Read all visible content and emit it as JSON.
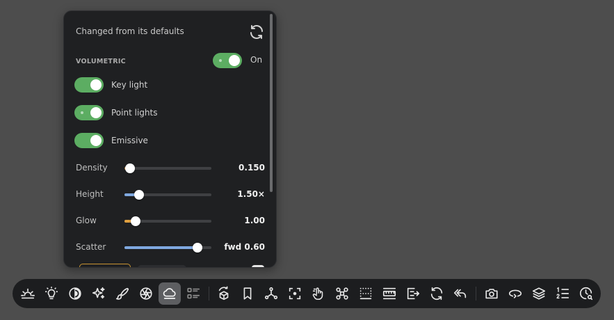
{
  "panel": {
    "header": "Changed from its defaults",
    "section": {
      "label": "VOLUMETRIC",
      "toggle_state": "On"
    },
    "toggles": [
      {
        "label": "Key light",
        "on": true
      },
      {
        "label": "Point lights",
        "on": true
      },
      {
        "label": "Emissive",
        "on": true
      }
    ],
    "sliders": [
      {
        "label": "Density",
        "value": "0.150",
        "fraction": 0.06,
        "fill_color": "#c98a3a"
      },
      {
        "label": "Height",
        "value": "1.50×",
        "fraction": 0.17,
        "fill_color": "#7fa8e0"
      },
      {
        "label": "Glow",
        "value": "1.00",
        "fraction": 0.13,
        "fill_color": "#e0a040"
      },
      {
        "label": "Scatter",
        "value": "fwd 0.60",
        "fraction": 0.84,
        "fill_color": "#7fa8e0"
      }
    ]
  },
  "toolbar": {
    "active": "fog-cloud-icon",
    "buttons": [
      "sunrise-icon",
      "lightbulb-icon",
      "contrast-icon",
      "sparkles-icon",
      "brush-icon",
      "aperture-icon",
      "fog-cloud-icon",
      "list-icon",
      "cube-rotate-icon",
      "bookmark-icon",
      "nodes-icon",
      "focus-icon",
      "hand-pointer-icon",
      "drone-icon",
      "grid-dots-icon",
      "ruler-icon",
      "export-icon",
      "refresh-icon",
      "reply-icon",
      "camera-icon",
      "orbit-icon",
      "layers-icon",
      "numbered-list-icon",
      "time-search-icon"
    ]
  },
  "colors": {
    "accent_green": "#5cad62",
    "panel_bg": "#1f2022",
    "toolbar_bg": "#1c1d1f"
  }
}
